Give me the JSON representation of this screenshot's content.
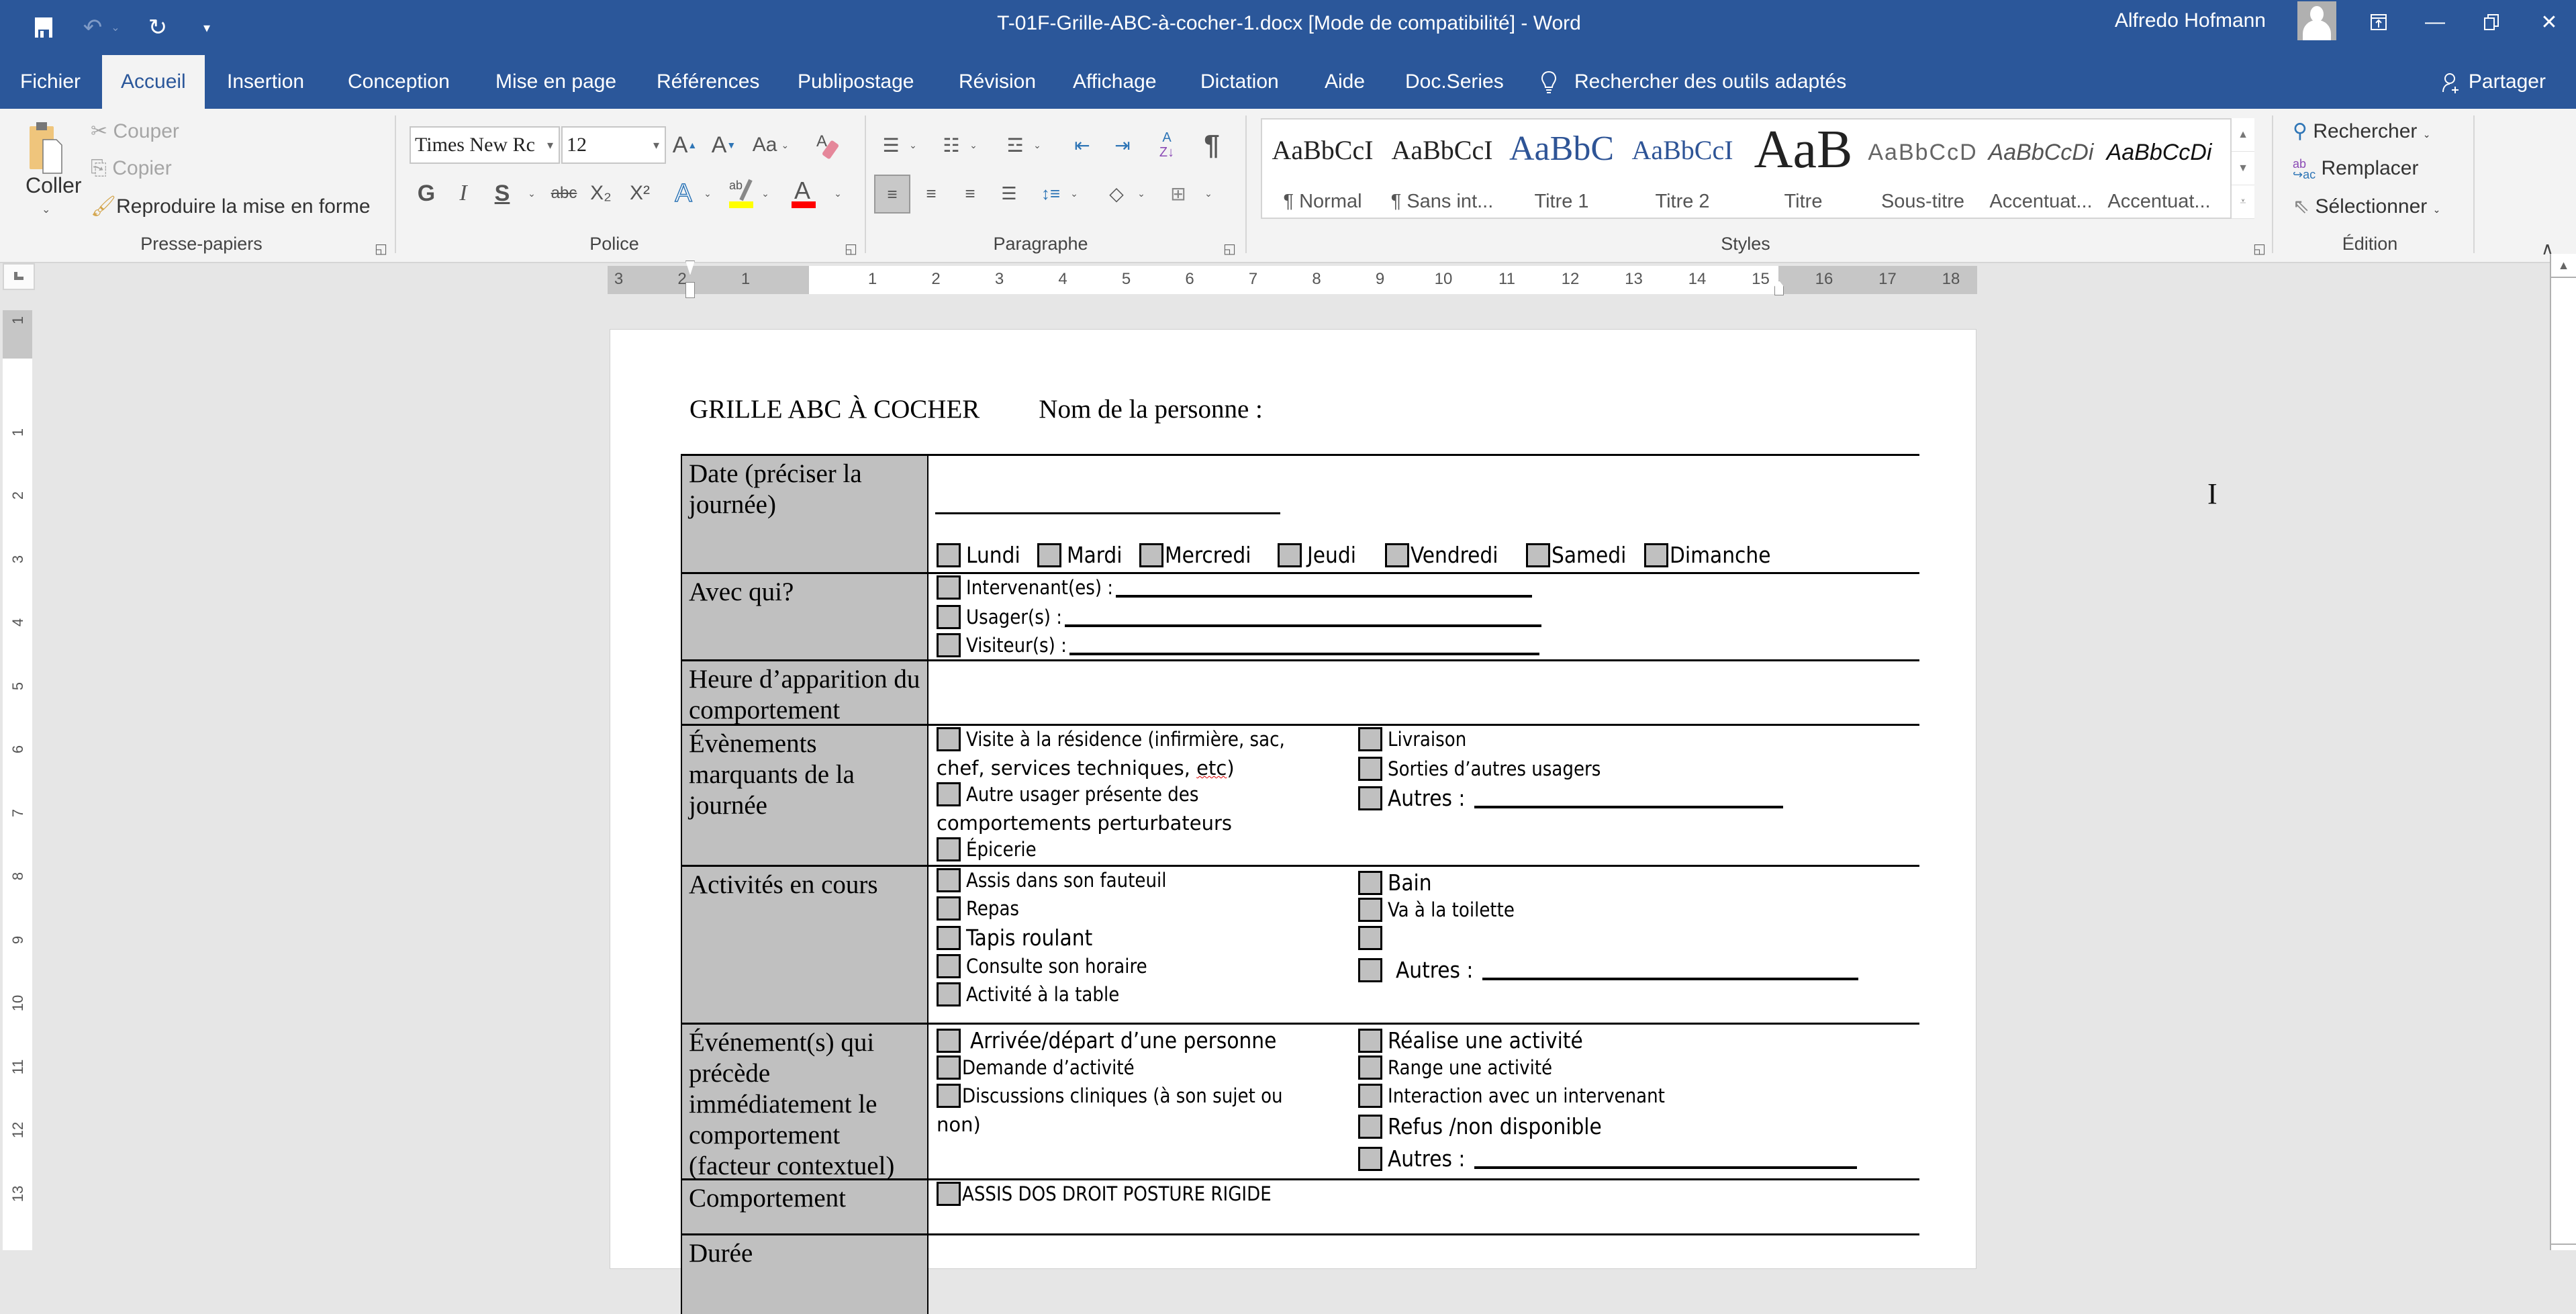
{
  "titlebar": {
    "document_title": "T-01F-Grille-ABC-à-cocher-1.docx [Mode de compatibilité]  -  Word",
    "user_name": "Alfredo Hofmann",
    "quick_access": [
      "save-icon",
      "undo-icon",
      "redo-icon",
      "customize-icon"
    ]
  },
  "tabs": [
    "Fichier",
    "Accueil",
    "Insertion",
    "Conception",
    "Mise en page",
    "Références",
    "Publipostage",
    "Révision",
    "Affichage",
    "Dictation",
    "Aide",
    "Doc.Series"
  ],
  "active_tab": "Accueil",
  "tell_me": "Rechercher des outils adaptés",
  "share": "Partager",
  "ribbon": {
    "clipboard": {
      "label": "Presse-papiers",
      "paste": "Coller",
      "cut": "Couper",
      "copy": "Copier",
      "format_painter": "Reproduire la mise en forme"
    },
    "font": {
      "label": "Police",
      "font_name": "Times New Rc",
      "font_size": "12",
      "grow": "A",
      "shrink": "A",
      "case": "Aa",
      "bold": "G",
      "italic": "I",
      "underline": "S",
      "strike": "abc",
      "subscript": "X₂",
      "superscript": "X²",
      "highlight_color": "#ffff00",
      "font_color": "#ff0000"
    },
    "paragraph": {
      "label": "Paragraphe"
    },
    "styles": {
      "label": "Styles",
      "items": [
        {
          "sample": "AaBbCcI",
          "name": "¶ Normal"
        },
        {
          "sample": "AaBbCcI",
          "name": "¶ Sans int..."
        },
        {
          "sample": "AaBbC",
          "name": "Titre 1"
        },
        {
          "sample": "AaBbCcI",
          "name": "Titre 2"
        },
        {
          "sample": "AaB",
          "name": "Titre"
        },
        {
          "sample": "AaBbCcD",
          "name": "Sous-titre"
        },
        {
          "sample": "AaBbCcDi",
          "name": "Accentuat..."
        },
        {
          "sample": "AaBbCcDi",
          "name": "Accentuat..."
        }
      ]
    },
    "editing": {
      "label": "Édition",
      "find": "Rechercher",
      "replace": "Remplacer",
      "select": "Sélectionner"
    }
  },
  "ruler": {
    "horizontal": [
      "3",
      "2",
      "1",
      "1",
      "2",
      "3",
      "4",
      "5",
      "6",
      "7",
      "8",
      "9",
      "10",
      "11",
      "12",
      "13",
      "14",
      "15",
      "16",
      "17",
      "18"
    ],
    "vertical": [
      "1",
      "1",
      "2",
      "3",
      "4",
      "5",
      "6",
      "7",
      "8",
      "9",
      "10",
      "11",
      "12",
      "13"
    ]
  },
  "document": {
    "heading": "GRILLE ABC À COCHER",
    "person_label": "Nom de la personne :",
    "rows": {
      "date": {
        "label": "Date (préciser la journée)",
        "days": [
          "Lundi",
          "Mardi",
          "Mercredi",
          "Jeudi",
          "Vendredi",
          "Samedi",
          "Dimanche"
        ]
      },
      "with_whom": {
        "label": "Avec qui?",
        "items": [
          "Intervenant(es) :",
          "Usager(s) :",
          "Visiteur(s) :"
        ]
      },
      "time": {
        "label": "Heure d’apparition du comportement"
      },
      "events": {
        "label": "Évènements marquants de la journée",
        "left": [
          "Visite à la résidence (infirmière, sac,",
          "chef, services techniques, etc)",
          "Autre usager présente des",
          "comportements perturbateurs",
          "Épicerie"
        ],
        "right": [
          "Livraison",
          "Sorties d’autres usagers",
          "Autres :"
        ]
      },
      "activities": {
        "label": "Activités en cours",
        "left": [
          "Assis dans son fauteuil",
          "Repas",
          "Tapis roulant",
          "Consulte son horaire",
          "Activité à la table"
        ],
        "right": [
          "Bain",
          "Va à la toilette",
          "",
          "Autres :"
        ]
      },
      "antecedent": {
        "label": "Événement(s) qui précède immédiatement le comportement (facteur contextuel)",
        "left": [
          "Arrivée/départ d’une personne",
          "Demande d’activité",
          "Discussions cliniques (à son sujet ou",
          "non)"
        ],
        "right": [
          "Réalise une activité",
          "Range une activité",
          "Interaction avec un intervenant",
          "Refus /non disponible",
          "Autres :"
        ]
      },
      "behaviour": {
        "label": "Comportement",
        "items": [
          "ASSIS DOS DROIT POSTURE RIGIDE"
        ]
      },
      "duration": {
        "label": "Durée"
      }
    }
  }
}
